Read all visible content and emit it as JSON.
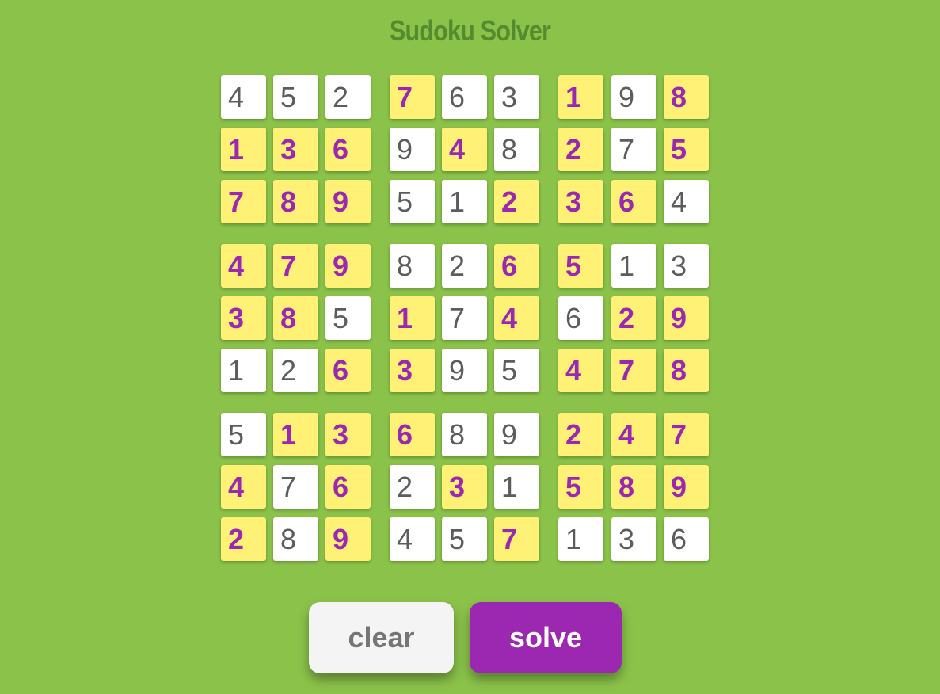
{
  "title": "Sudoku Solver",
  "grid": [
    [
      "4",
      "5",
      "2",
      "7",
      "6",
      "3",
      "1",
      "9",
      "8"
    ],
    [
      "1",
      "3",
      "6",
      "9",
      "4",
      "8",
      "2",
      "7",
      "5"
    ],
    [
      "7",
      "8",
      "9",
      "5",
      "1",
      "2",
      "3",
      "6",
      "4"
    ],
    [
      "4",
      "7",
      "9",
      "8",
      "2",
      "6",
      "5",
      "1",
      "3"
    ],
    [
      "3",
      "8",
      "5",
      "1",
      "7",
      "4",
      "6",
      "2",
      "9"
    ],
    [
      "1",
      "2",
      "6",
      "3",
      "9",
      "5",
      "4",
      "7",
      "8"
    ],
    [
      "5",
      "1",
      "3",
      "6",
      "8",
      "9",
      "2",
      "4",
      "7"
    ],
    [
      "4",
      "7",
      "6",
      "2",
      "3",
      "1",
      "5",
      "8",
      "9"
    ],
    [
      "2",
      "8",
      "9",
      "4",
      "5",
      "7",
      "1",
      "3",
      "6"
    ]
  ],
  "given": [
    [
      1,
      1,
      1,
      0,
      1,
      1,
      0,
      1,
      0
    ],
    [
      0,
      0,
      0,
      1,
      0,
      1,
      0,
      1,
      0
    ],
    [
      0,
      0,
      0,
      1,
      1,
      0,
      0,
      0,
      1
    ],
    [
      0,
      0,
      0,
      1,
      1,
      0,
      0,
      1,
      1
    ],
    [
      0,
      0,
      1,
      0,
      1,
      0,
      1,
      0,
      0
    ],
    [
      1,
      1,
      0,
      0,
      1,
      1,
      0,
      0,
      0
    ],
    [
      1,
      0,
      0,
      0,
      1,
      1,
      0,
      0,
      0
    ],
    [
      0,
      1,
      0,
      1,
      0,
      1,
      0,
      0,
      0
    ],
    [
      0,
      1,
      0,
      1,
      1,
      0,
      1,
      1,
      1
    ]
  ],
  "buttons": {
    "clear_label": "clear",
    "solve_label": "solve"
  },
  "colors": {
    "background": "#8bc34a",
    "title": "#558b2f",
    "given_cell": "#ffffff",
    "given_text": "#5c5c5c",
    "solved_cell": "#fff176",
    "solved_text": "#9c27b0",
    "solve_button": "#9c27b0",
    "clear_button": "#f4f4f4"
  }
}
